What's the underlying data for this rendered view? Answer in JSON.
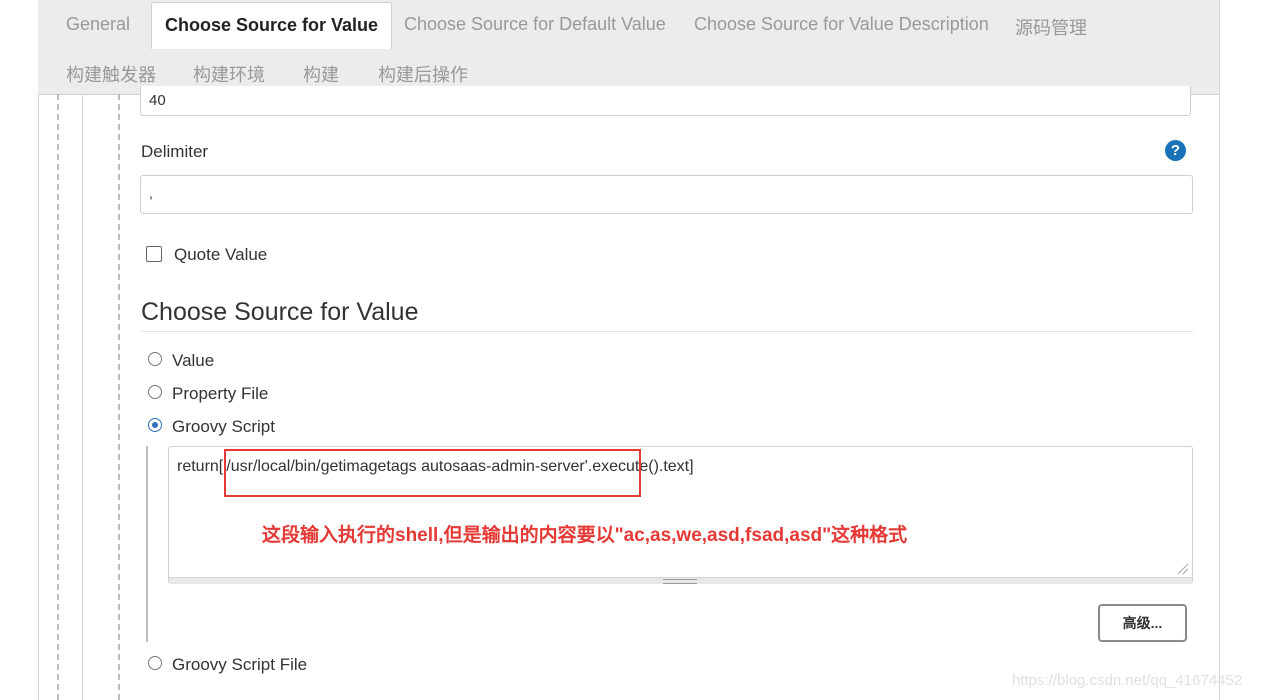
{
  "tabs": {
    "general": "General",
    "choose_source_value": "Choose Source for Value",
    "choose_source_default": "Choose Source for Default Value",
    "choose_source_description": "Choose Source for Value Description",
    "source_management": "源码管理",
    "build_triggers": "构建触发器",
    "build_env": "构建环境",
    "build": "构建",
    "post_build": "构建后操作"
  },
  "fields": {
    "top_input_value": "40",
    "delimiter_label": "Delimiter",
    "delimiter_value": ",",
    "help_icon_glyph": "?",
    "quote_value_label": "Quote Value"
  },
  "section": {
    "title": "Choose Source for Value",
    "options": [
      "Value",
      "Property File",
      "Groovy Script",
      "Groovy Script File"
    ],
    "selected": "Groovy Script"
  },
  "groovy": {
    "script": "return['/usr/local/bin/getimagetags autosaas-admin-server'.execute().text]"
  },
  "annotation": {
    "text": "这段输入执行的shell,但是输出的内容要以\"ac,as,we,asd,fsad,asd\"这种格式",
    "color": "#e53935"
  },
  "advanced_button": "高级...",
  "watermark": "https://blog.csdn.net/qq_41674452",
  "colors": {
    "accent": "#2d6fb8",
    "help": "#1a73b8",
    "tabbar": "#ececec"
  }
}
